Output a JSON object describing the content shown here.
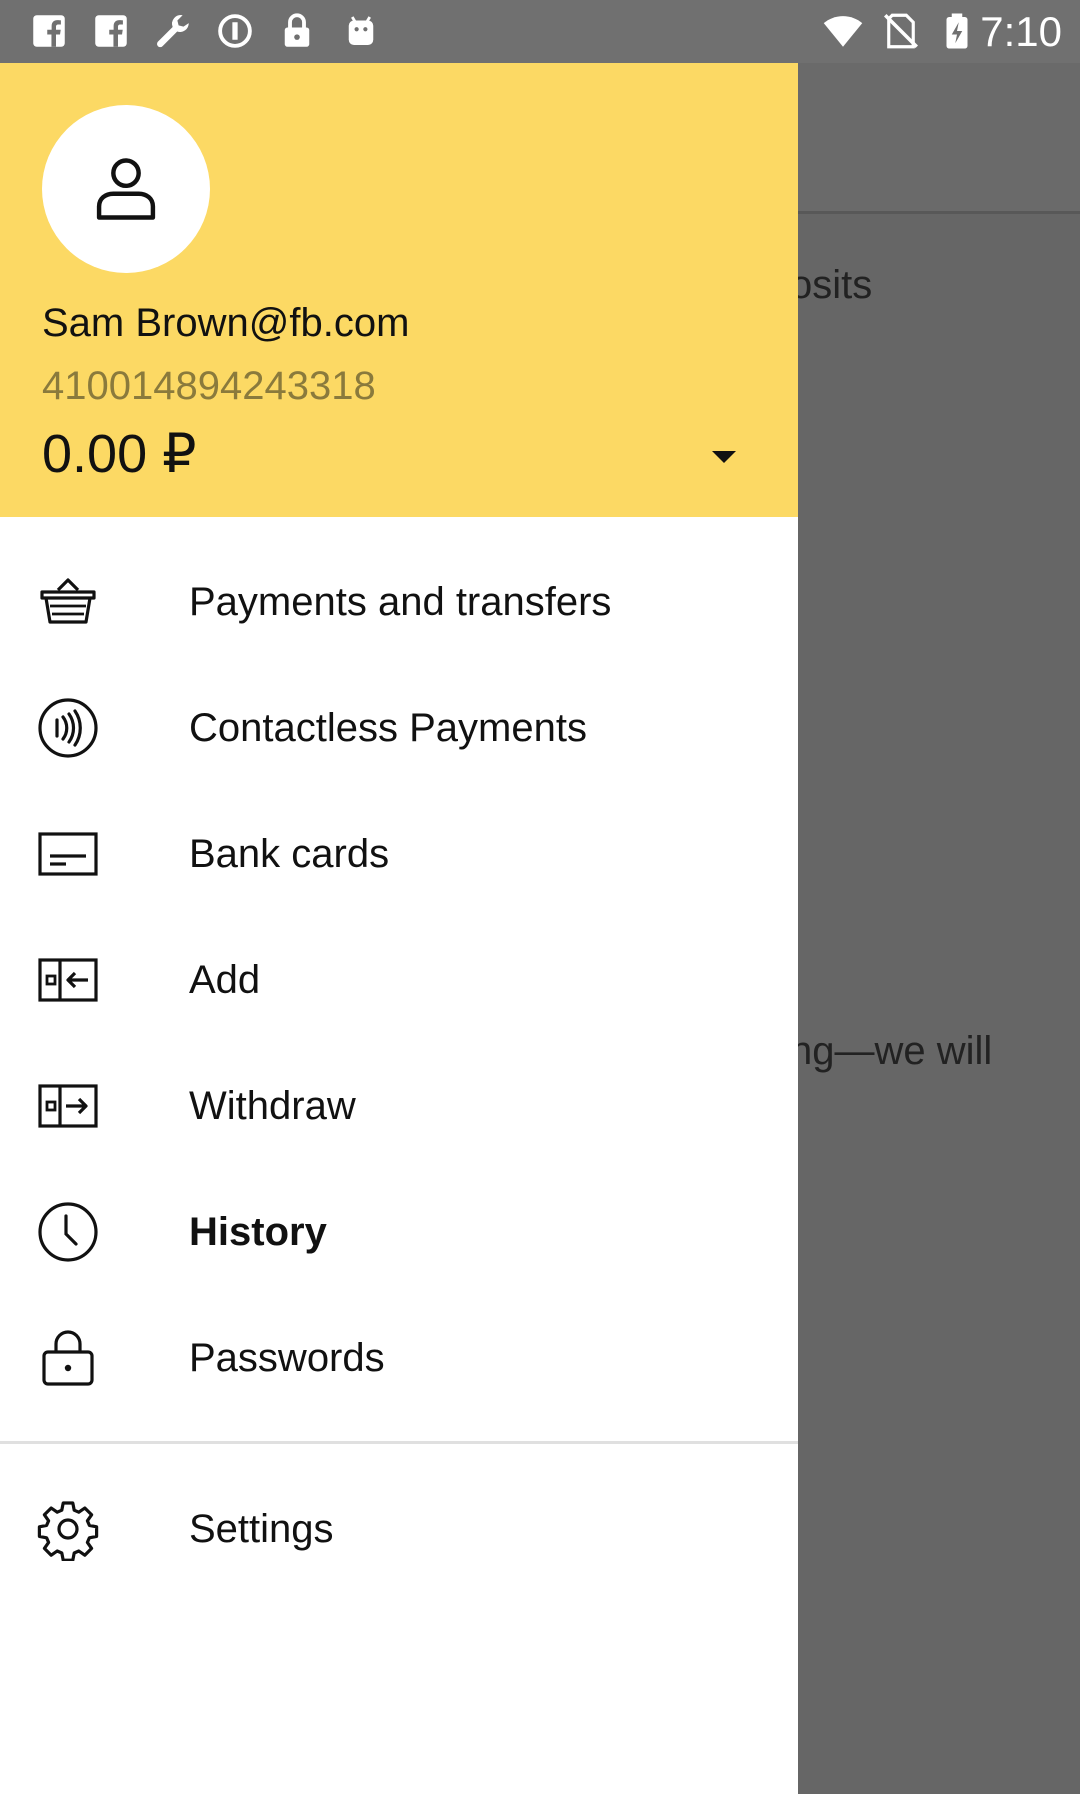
{
  "status_bar": {
    "time": "7:10",
    "left_icons": [
      "facebook-icon",
      "facebook-icon",
      "wrench-icon",
      "sync-icon",
      "lock-icon",
      "android-icon"
    ],
    "right_icons": [
      "wifi-icon",
      "no-sim-icon",
      "battery-charging-icon"
    ]
  },
  "background": {
    "text_1": "osits",
    "text_2": "ng—we will"
  },
  "account": {
    "email": "Sam Brown@fb.com",
    "number": "410014894243318",
    "balance": "0.00 ₽"
  },
  "menu": {
    "items": [
      {
        "label": "Payments and transfers",
        "icon": "basket-icon"
      },
      {
        "label": "Contactless Payments",
        "icon": "contactless-icon"
      },
      {
        "label": "Bank cards",
        "icon": "card-icon"
      },
      {
        "label": "Add",
        "icon": "add-funds-icon"
      },
      {
        "label": "Withdraw",
        "icon": "withdraw-icon"
      },
      {
        "label": "History",
        "icon": "clock-icon",
        "selected": true
      },
      {
        "label": "Passwords",
        "icon": "lock-icon"
      }
    ],
    "settings": {
      "label": "Settings",
      "icon": "gear-icon"
    }
  },
  "colors": {
    "header_bg": "#fcd964",
    "status_bar_bg": "#707070",
    "scrim": "#666666",
    "account_number": "#8a7a3c"
  }
}
